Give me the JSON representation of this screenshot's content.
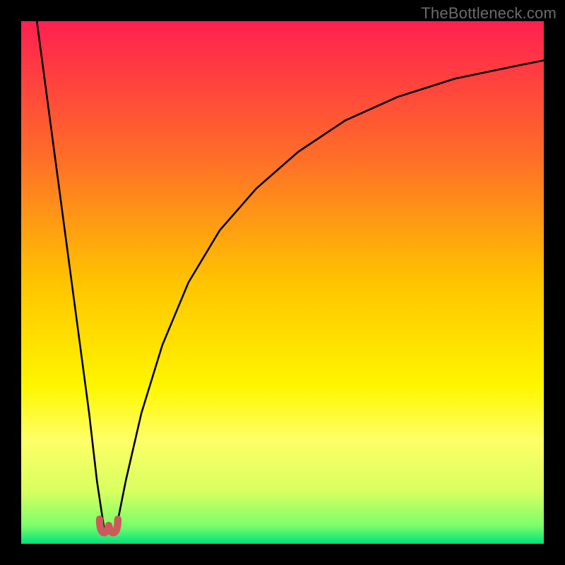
{
  "watermark": "TheBottleneck.com",
  "chart_data": {
    "type": "line",
    "title": "",
    "xlabel": "",
    "ylabel": "",
    "xlim": [
      0,
      100
    ],
    "ylim": [
      0,
      100
    ],
    "grid": false,
    "legend": false,
    "annotations": [],
    "gradient_stops": [
      {
        "offset": 0.0,
        "color": "#ff2050"
      },
      {
        "offset": 0.25,
        "color": "#ff6a2a"
      },
      {
        "offset": 0.5,
        "color": "#ffc400"
      },
      {
        "offset": 0.7,
        "color": "#fff600"
      },
      {
        "offset": 0.8,
        "color": "#ffff66"
      },
      {
        "offset": 0.9,
        "color": "#d8ff60"
      },
      {
        "offset": 0.965,
        "color": "#7bff6a"
      },
      {
        "offset": 1.0,
        "color": "#00e07a"
      }
    ],
    "series": [
      {
        "name": "left-branch",
        "x": [
          3,
          5,
          7,
          9,
          11,
          13,
          14.5,
          16
        ],
        "y": [
          100,
          85,
          70,
          55,
          40,
          25,
          12,
          2
        ]
      },
      {
        "name": "right-branch",
        "x": [
          18,
          20,
          23,
          27,
          32,
          38,
          45,
          53,
          62,
          72,
          83,
          95,
          100
        ],
        "y": [
          2,
          12,
          25,
          38,
          50,
          60,
          68,
          75,
          81,
          85.5,
          89,
          91.5,
          92.5
        ]
      }
    ],
    "marker": {
      "name": "min-marker",
      "color": "#cc5a5a",
      "x_range": [
        15,
        18.5
      ],
      "y": 1.5,
      "shape": "u"
    }
  }
}
